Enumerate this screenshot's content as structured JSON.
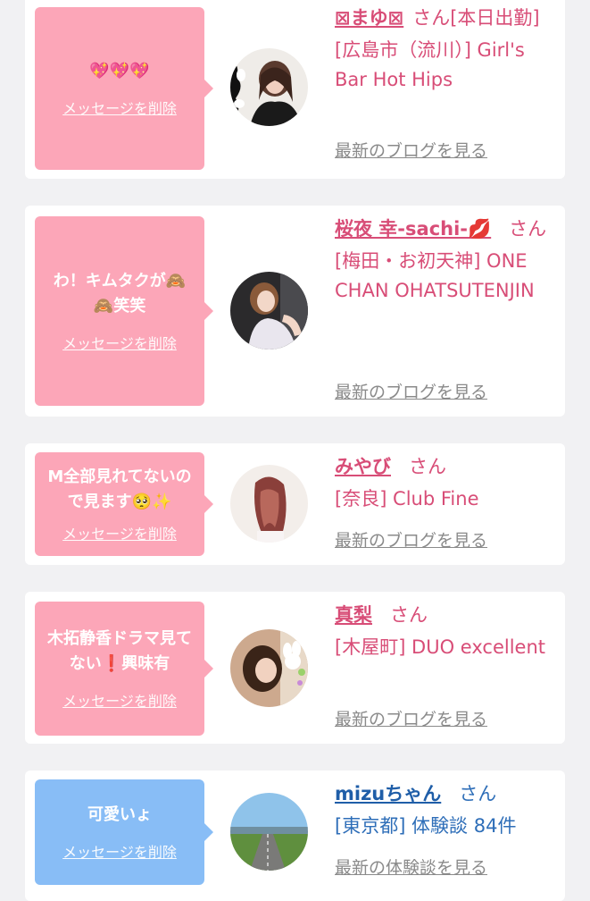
{
  "cards": [
    {
      "bubble_message": "💖💖💖",
      "delete_label": "メッセージを削除",
      "name": "⊠まゆ⊠",
      "honorific": "さん",
      "status": "[本日出勤]",
      "location": "[広島市（流川）] Girl's Bar Hot Hips",
      "link": "最新のブログを見る",
      "avatar_icon": "avatar-photo-icon"
    },
    {
      "bubble_message": "わ！キムタクが🙈🙈笑笑",
      "delete_label": "メッセージを削除",
      "name": "桜夜 幸-sachi-💋",
      "honorific": "さん",
      "location": "[梅田・お初天神] ONE CHAN OHATSUTENJIN",
      "link": "最新のブログを見る",
      "avatar_icon": "avatar-photo-icon"
    },
    {
      "bubble_message": "M全部見れてないので見ます🥺✨",
      "delete_label": "メッセージを削除",
      "name": "みやび",
      "honorific": "さん",
      "location": "[奈良] Club Fine",
      "link": "最新のブログを見る",
      "avatar_icon": "avatar-photo-icon"
    },
    {
      "bubble_message": "木拓静香ドラマ見てない❗興味有",
      "delete_label": "メッセージを削除",
      "name": "真梨",
      "honorific": "さん",
      "location": "[木屋町] DUO excellent",
      "link": "最新のブログを見る",
      "avatar_icon": "avatar-photo-icon"
    },
    {
      "bubble_message": "可愛いょ",
      "delete_label": "メッセージを削除",
      "name": "mizuちゃん",
      "honorific": "さん",
      "location": "[東京都] 体験談 84件",
      "link": "最新の体験談を見る",
      "avatar_icon": "avatar-landscape-icon"
    }
  ],
  "colors": {
    "pink_bubble": "#fca6b8",
    "blue_bubble": "#88bdf6",
    "pink_text": "#d84d77",
    "blue_text": "#2e6eb8"
  }
}
